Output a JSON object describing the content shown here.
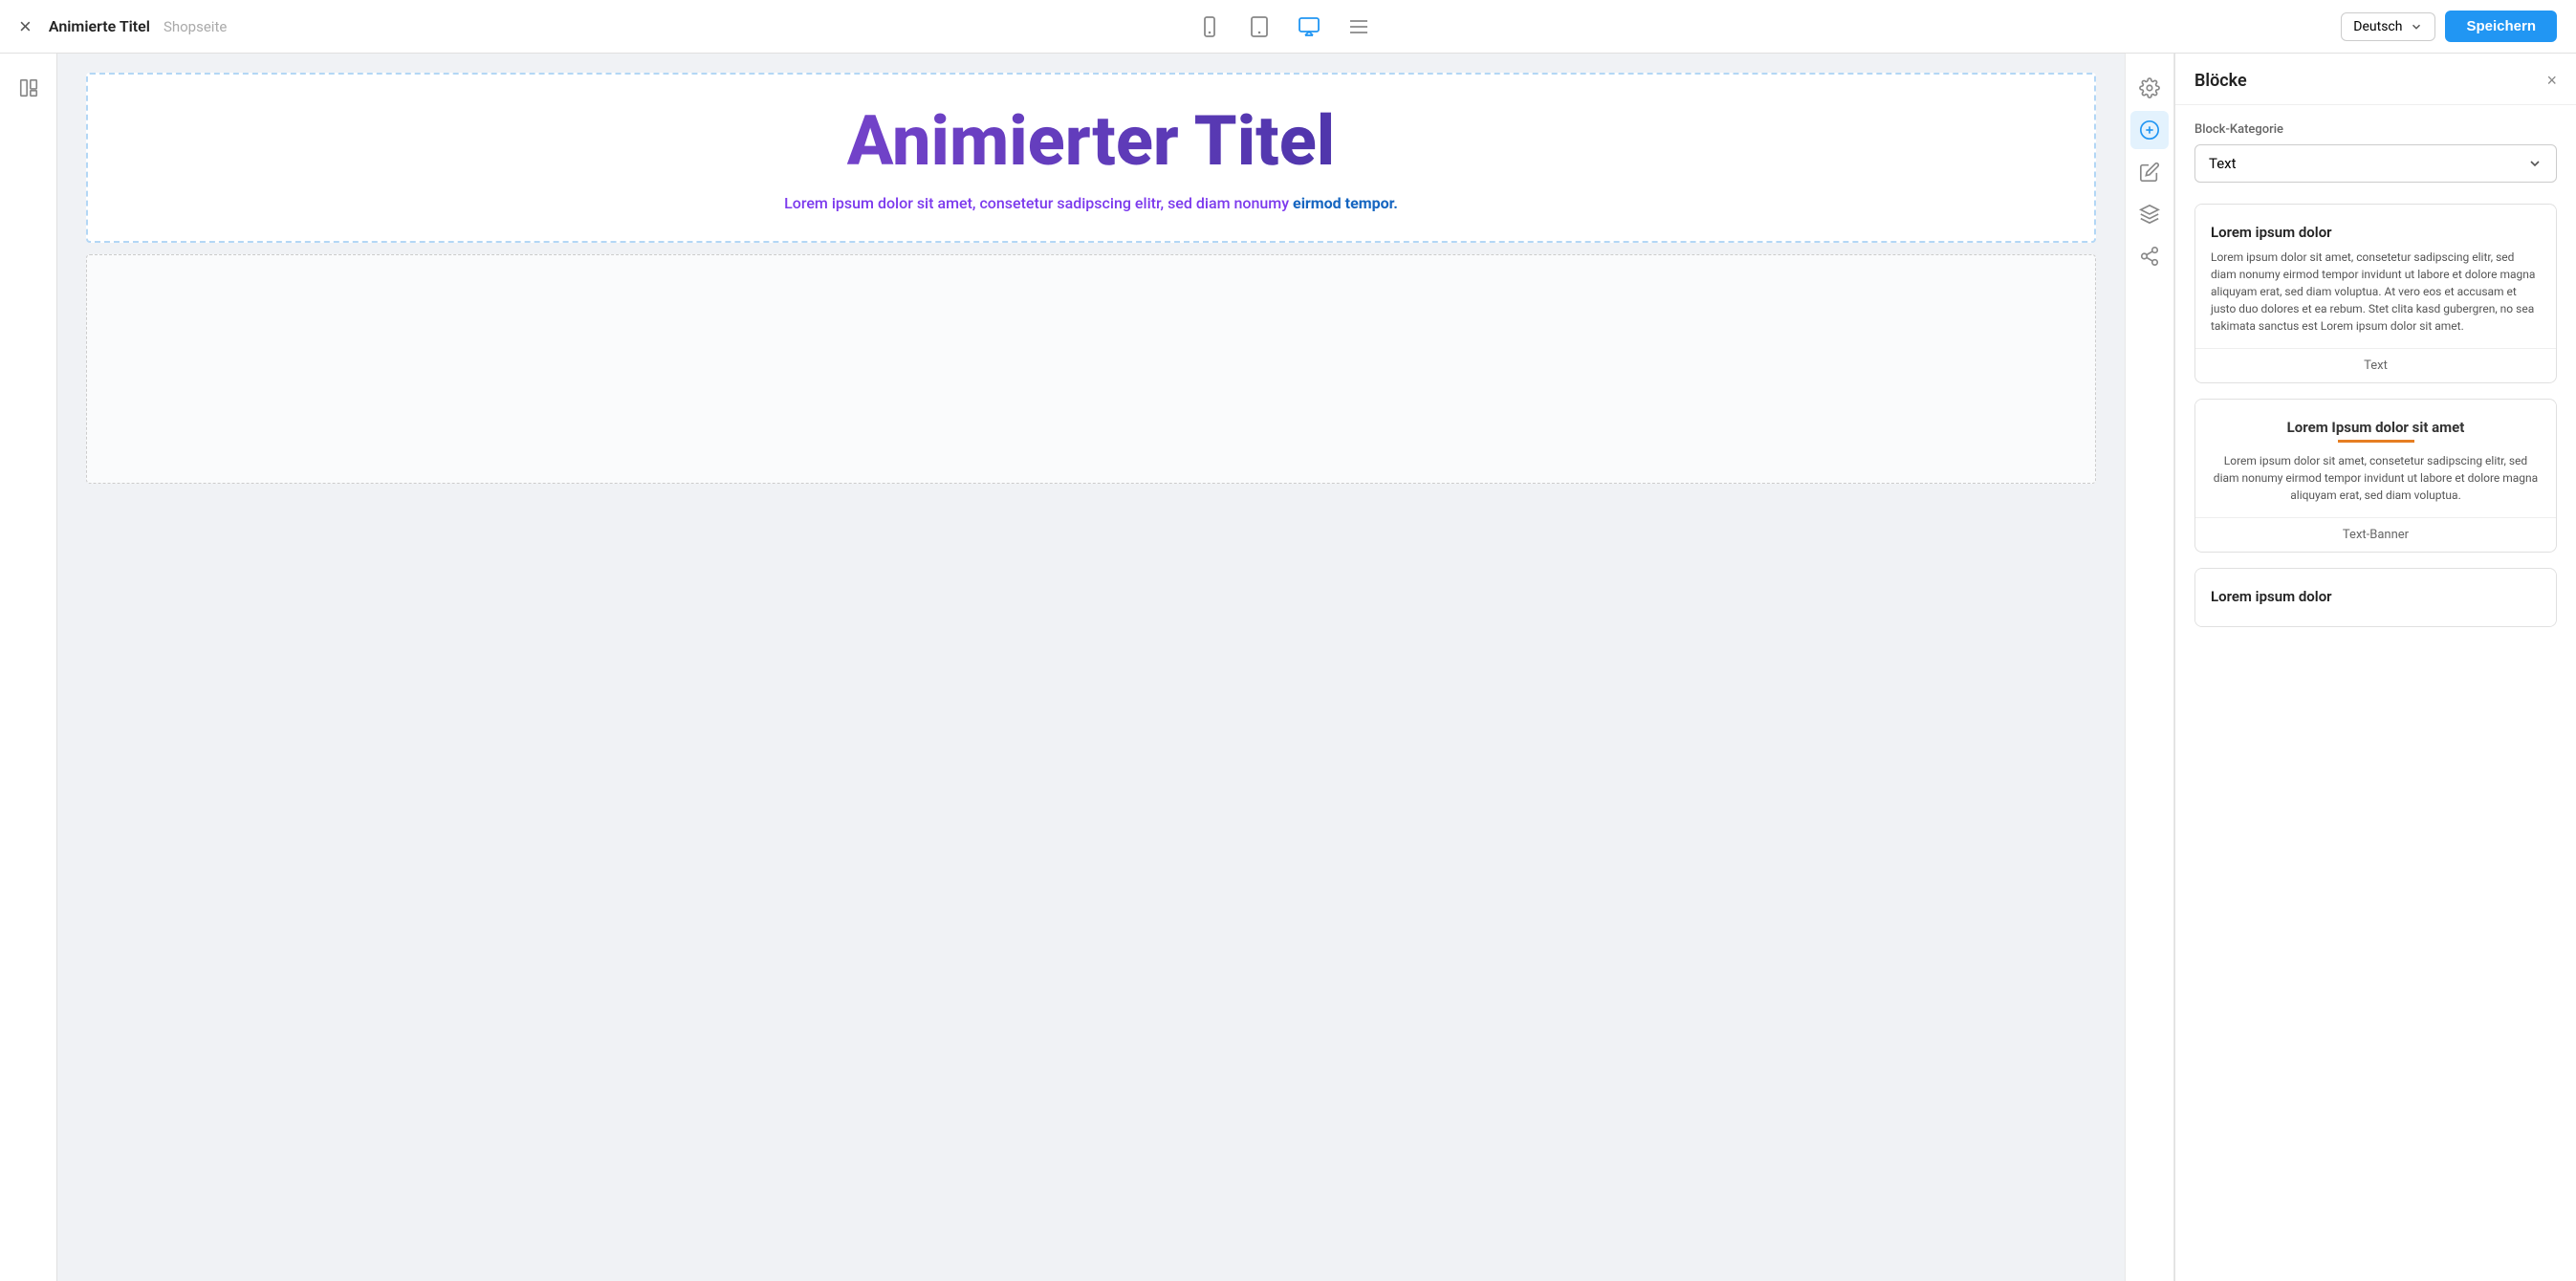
{
  "topbar": {
    "title": "Animierte Titel",
    "subtitle": "Shopseite",
    "close_label": "×",
    "language": "Deutsch",
    "save_label": "Speichern"
  },
  "devices": [
    {
      "name": "mobile",
      "label": "Mobile"
    },
    {
      "name": "tablet",
      "label": "Tablet"
    },
    {
      "name": "desktop",
      "label": "Desktop",
      "active": true
    },
    {
      "name": "list",
      "label": "List"
    }
  ],
  "right_panel": {
    "title": "Blöcke",
    "close_label": "×",
    "block_category_label": "Block-Kategorie",
    "selected_category": "Text",
    "blocks": [
      {
        "id": "block-text",
        "preview_title": "Lorem ipsum dolor",
        "preview_body": "Lorem ipsum dolor sit amet, consetetur sadipscing elitr, sed diam nonumy eirmod tempor invidunt ut labore et dolore magna aliquyam erat, sed diam voluptua. At vero eos et accusam et justo duo dolores et ea rebum. Stet clita kasd gubergren, no sea takimata sanctus est Lorem ipsum dolor sit amet.",
        "footer_label": "Text"
      },
      {
        "id": "block-text-banner",
        "preview_title": "Lorem Ipsum dolor sit amet",
        "preview_body": "Lorem ipsum dolor sit amet, consetetur sadipscing elitr, sed diam nonumy eirmod tempor invidunt ut labore et dolore magna aliquyam erat, sed diam voluptua.",
        "footer_label": "Text-Banner"
      },
      {
        "id": "block-lorem",
        "preview_title": "Lorem ipsum dolor",
        "footer_label": ""
      }
    ]
  },
  "canvas": {
    "block1": {
      "animated_title": "Animierter Titel",
      "subtitle_start": "Lorem ipsum dolor sit amet, consetetur sadipscing elitr, sed diam nonumy ",
      "subtitle_bold": "eirmod tempor.",
      "subtitle_full": "Lorem ipsum dolor sit amet, consetetur sadipscing elitr, sed diam nonumy eirmod tempor."
    }
  }
}
